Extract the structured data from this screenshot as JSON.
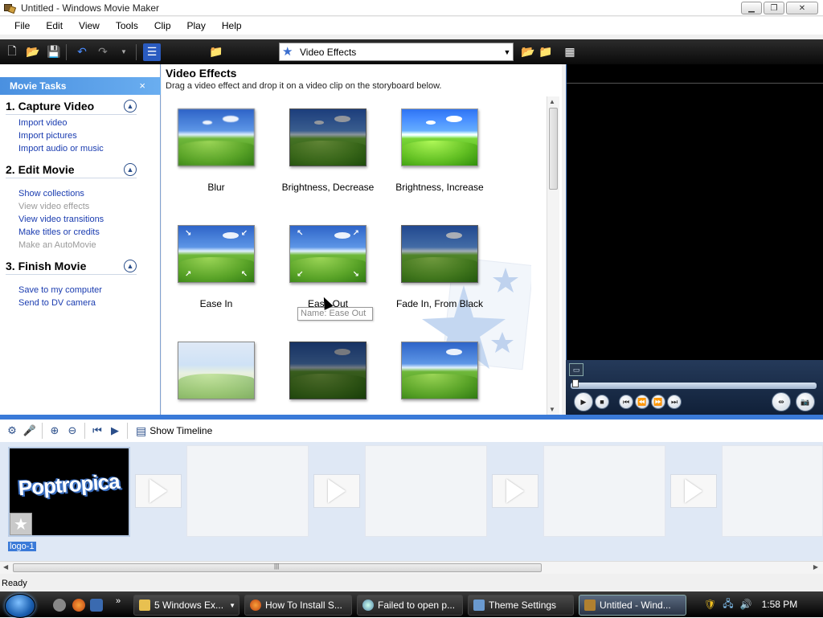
{
  "window": {
    "title": "Untitled - Windows Movie Maker"
  },
  "menu": [
    "File",
    "Edit",
    "View",
    "Tools",
    "Clip",
    "Play",
    "Help"
  ],
  "toolbar": {
    "collection_select": "Video Effects"
  },
  "task_pane": {
    "header": "Movie Tasks",
    "sections": [
      {
        "title": "1. Capture Video",
        "links": [
          {
            "label": "Import video",
            "enabled": true
          },
          {
            "label": "Import pictures",
            "enabled": true
          },
          {
            "label": "Import audio or music",
            "enabled": true
          }
        ]
      },
      {
        "title": "2. Edit Movie",
        "links": [
          {
            "label": "Show collections",
            "enabled": true
          },
          {
            "label": "View video effects",
            "enabled": false
          },
          {
            "label": "View video transitions",
            "enabled": true
          },
          {
            "label": "Make titles or credits",
            "enabled": true
          },
          {
            "label": "Make an AutoMovie",
            "enabled": false
          }
        ]
      },
      {
        "title": "3. Finish Movie",
        "links": [
          {
            "label": "Save to my computer",
            "enabled": true
          },
          {
            "label": "Send to DV camera",
            "enabled": true
          }
        ]
      }
    ]
  },
  "effects": {
    "title": "Video Effects",
    "subtitle": "Drag a video effect and drop it on a video clip on the storyboard below.",
    "items": [
      {
        "label": "Blur"
      },
      {
        "label": "Brightness, Decrease"
      },
      {
        "label": "Brightness, Increase"
      },
      {
        "label": "Ease In"
      },
      {
        "label": "Ease Out"
      },
      {
        "label": "Fade In, From Black"
      },
      {
        "label": ""
      },
      {
        "label": ""
      },
      {
        "label": ""
      }
    ],
    "tooltip": "Name: Ease Out"
  },
  "storyboard": {
    "show_timeline_label": "Show Timeline",
    "clip_label": "logo-1",
    "clip_text": "Poptropica"
  },
  "status": {
    "text": "Ready"
  },
  "taskbar": {
    "buttons": [
      {
        "label": "5 Windows Ex..."
      },
      {
        "label": "How To Install S..."
      },
      {
        "label": "Failed to open p..."
      },
      {
        "label": "Theme Settings"
      },
      {
        "label": "Untitled - Wind..."
      }
    ],
    "clock": "1:58 PM"
  },
  "colors": {
    "accent": "#3a7ad8",
    "link": "#1a3cb0",
    "disabled": "#9a9a9a"
  }
}
